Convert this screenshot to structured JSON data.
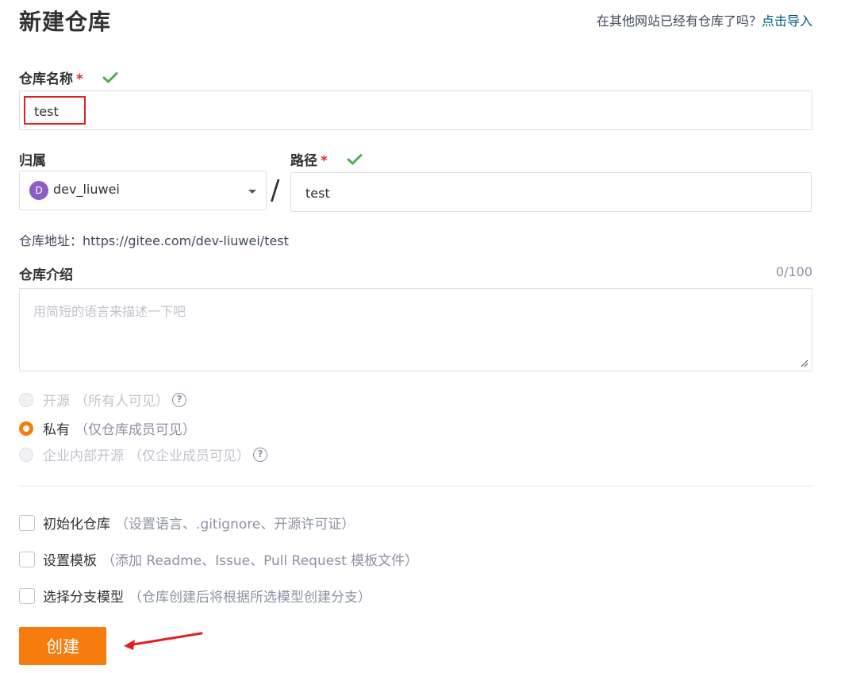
{
  "header": {
    "title": "新建仓库",
    "import_question": "在其他网站已经有仓库了吗？",
    "import_link": "点击导入"
  },
  "repo_name": {
    "label": "仓库名称",
    "required_mark": "*",
    "value": "test"
  },
  "owner": {
    "label": "归属",
    "avatar_letter": "D",
    "value": "dev_liuwei"
  },
  "separator": "/",
  "path": {
    "label": "路径",
    "required_mark": "*",
    "value": "test"
  },
  "repo_address": {
    "prefix": "仓库地址：",
    "url": "https://gitee.com/dev-liuwei/test"
  },
  "description": {
    "label": "仓库介绍",
    "counter": "0/100",
    "placeholder": "用简短的语言来描述一下吧"
  },
  "visibility": {
    "options": [
      {
        "label": "开源",
        "desc": "（所有人可见）",
        "selected": false,
        "disabled": true,
        "help": "?"
      },
      {
        "label": "私有",
        "desc": "（仅仓库成员可见）",
        "selected": true,
        "disabled": false
      },
      {
        "label": "企业内部开源",
        "desc": "（仅企业成员可见）",
        "selected": false,
        "disabled": true,
        "help": "?"
      }
    ]
  },
  "options": [
    {
      "label": "初始化仓库",
      "desc": "（设置语言、.gitignore、开源许可证）",
      "checked": false
    },
    {
      "label": "设置模板",
      "desc": "（添加 Readme、Issue、Pull Request 模板文件）",
      "checked": false
    },
    {
      "label": "选择分支模型",
      "desc": "（仓库创建后将根据所选模型创建分支）",
      "checked": false
    }
  ],
  "submit": {
    "label": "创建"
  },
  "colors": {
    "primary": "#f57c0d",
    "link": "#005980",
    "required": "#e12f2f",
    "valid_check": "#4caf50",
    "annotation": "#e02020"
  },
  "icons": {
    "valid": "check-icon",
    "help": "question-circle-icon",
    "dropdown": "caret-down-icon",
    "annotation": "red-arrow"
  }
}
